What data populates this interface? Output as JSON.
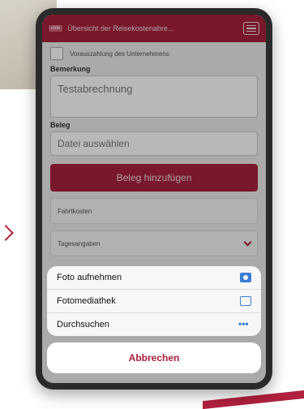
{
  "header": {
    "badge": "elde",
    "title": "Übersicht der Reisekostenabre..."
  },
  "form": {
    "prepayment_label": "Vorauszahlung des Unternehmens",
    "remark_label": "Bemerkung",
    "remark_value": "Testabrechnung",
    "receipt_label": "Beleg",
    "file_placeholder": "Datei auswählen",
    "add_receipt_button": "Beleg hinzufügen"
  },
  "sections": [
    {
      "label": "Fahrtkosten"
    },
    {
      "label": "Tagesangaben"
    }
  ],
  "action_sheet": {
    "items": [
      {
        "label": "Foto aufnehmen",
        "icon": "camera-icon"
      },
      {
        "label": "Fotomediathek",
        "icon": "folder-icon"
      },
      {
        "label": "Durchsuchen",
        "icon": "more-icon"
      }
    ],
    "cancel_label": "Abbrechen"
  },
  "colors": {
    "brand": "#a8203c",
    "ios_blue": "#3b7ed6"
  }
}
